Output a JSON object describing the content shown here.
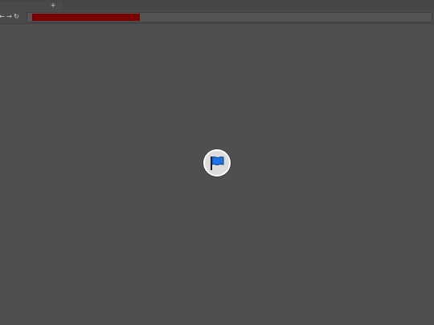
{
  "browser": {
    "tab_new_glyph": "+",
    "nav": {
      "back_glyph": "←",
      "forward_glyph": "→",
      "reload_glyph": "↻"
    },
    "address_bar": {
      "value_redacted": true
    }
  },
  "content": {
    "center_icon": "flag-icon"
  },
  "colors": {
    "background": "#4f4f4f",
    "redaction": "#7a0000",
    "flag_blue": "#1e73e8"
  }
}
